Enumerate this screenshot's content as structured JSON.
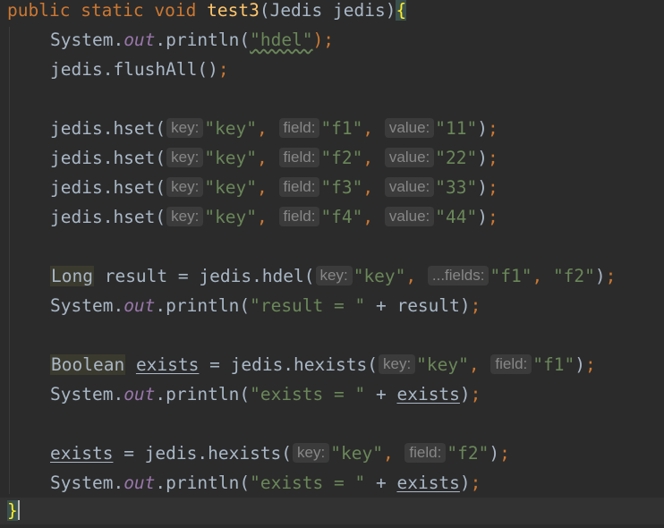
{
  "code": {
    "l1": {
      "kw_public": "public",
      "kw_static": "static",
      "kw_void": "void",
      "method_name": "test3",
      "open_paren": "(",
      "param_type": "Jedis",
      "param_name": "jedis",
      "close_paren": ")",
      "open_brace": "{"
    },
    "l2": {
      "cls": "System.",
      "fld": "out",
      "call": ".println(",
      "str": "\"hdel\"",
      "end": ");"
    },
    "l3": {
      "call": "jedis.flushAll()",
      "end": ";"
    },
    "hset": [
      {
        "call": "jedis.hset(",
        "hint_key": "key:",
        "v_key": "\"key\"",
        "hint_field": "field:",
        "v_field": "\"f1\"",
        "hint_value": "value:",
        "v_value": "\"11\"",
        "close": ")",
        "end": ";"
      },
      {
        "call": "jedis.hset(",
        "hint_key": "key:",
        "v_key": "\"key\"",
        "hint_field": "field:",
        "v_field": "\"f2\"",
        "hint_value": "value:",
        "v_value": "\"22\"",
        "close": ")",
        "end": ";"
      },
      {
        "call": "jedis.hset(",
        "hint_key": "key:",
        "v_key": "\"key\"",
        "hint_field": "field:",
        "v_field": "\"f3\"",
        "hint_value": "value:",
        "v_value": "\"33\"",
        "close": ")",
        "end": ";"
      },
      {
        "call": "jedis.hset(",
        "hint_key": "key:",
        "v_key": "\"key\"",
        "hint_field": "field:",
        "v_field": "\"f4\"",
        "hint_value": "value:",
        "v_value": "\"44\"",
        "close": ")",
        "end": ";"
      }
    ],
    "l9": {
      "type": "Long",
      "mid": " result = jedis.hdel(",
      "hint_key": "key:",
      "v_key": "\"key\"",
      "hint_fields": "...fields:",
      "v_f1": "\"f1\"",
      "v_f2": "\"f2\"",
      "close": ")",
      "end": ";"
    },
    "l10": {
      "cls": "System.",
      "fld": "out",
      "call": ".println(",
      "str": "\"result = \"",
      "rest": " + result)",
      "end": ";"
    },
    "l12": {
      "type": "Boolean",
      "var": "exists",
      "mid": " = jedis.hexists(",
      "hint_key": "key:",
      "v_key": "\"key\"",
      "hint_field": "field:",
      "v_field": "\"f1\"",
      "close": ")",
      "end": ";"
    },
    "l13": {
      "cls": "System.",
      "fld": "out",
      "call": ".println(",
      "str": "\"exists = \"",
      "plus": " + ",
      "var": "exists",
      "close": ")",
      "end": ";"
    },
    "l15": {
      "var": "exists",
      "mid": " = jedis.hexists(",
      "hint_key": "key:",
      "v_key": "\"key\"",
      "hint_field": "field:",
      "v_field": "\"f2\"",
      "close": ")",
      "end": ";"
    },
    "l16": {
      "cls": "System.",
      "fld": "out",
      "call": ".println(",
      "str": "\"exists = \"",
      "plus": " + ",
      "var": "exists",
      "close": ")",
      "end": ";"
    },
    "l17": {
      "close_brace": "}"
    }
  }
}
